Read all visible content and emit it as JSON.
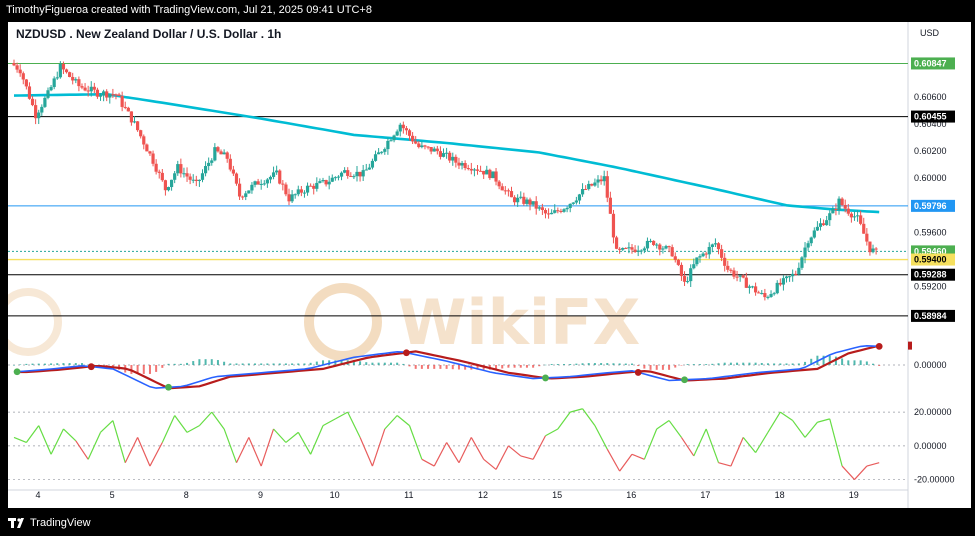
{
  "header": {
    "caption": "TimothyFigueroa created with TradingView.com, Jul 21, 2025 09:41 UTC+8"
  },
  "footer": {
    "brand": "TradingView"
  },
  "watermark": {
    "text": "WikiFX"
  },
  "colors": {
    "up": "#26a69a",
    "down": "#ef5350",
    "ema": "#00bcd4",
    "macd_line": "#2962ff",
    "signal_line": "#4caf50",
    "signal_down": "#b71c1c",
    "hist_pos": "#26a69a",
    "hist_neg": "#ef5350",
    "osc_pos": "#66dd44",
    "osc_neg": "#e85c5c",
    "level_green": "#4caf50",
    "level_blue": "#2196f3",
    "level_yellow": "#f6e05e",
    "level_black": "#000000"
  },
  "chart_data": {
    "type": "candlestick",
    "title": "NZDUSD . New Zealand Dollar / U.S. Dollar . 1h",
    "currency": "USD",
    "timeframe": "1h",
    "y_range": [
      0.5888,
      0.6102
    ],
    "y_ticks": [
      0.606,
      0.604,
      0.602,
      0.6,
      0.596,
      0.592,
      0.59
    ],
    "y_tick_labels": [
      "0.60600",
      "0.60400",
      "0.60200",
      "0.60000",
      "0.59600",
      "0.59200",
      "0.59000"
    ],
    "x_labels": [
      "4",
      "5",
      "8",
      "9",
      "10",
      "11",
      "12",
      "15",
      "16",
      "17",
      "18",
      "19"
    ],
    "x_label_index": [
      0,
      24,
      48,
      72,
      96,
      120,
      144,
      168,
      192,
      216,
      240,
      264
    ],
    "total_bars": 280,
    "price_anchors": [
      [
        0,
        0.6085
      ],
      [
        3,
        0.608
      ],
      [
        8,
        0.6047
      ],
      [
        12,
        0.6062
      ],
      [
        16,
        0.6082
      ],
      [
        22,
        0.6068
      ],
      [
        28,
        0.6063
      ],
      [
        34,
        0.6062
      ],
      [
        40,
        0.604
      ],
      [
        46,
        0.6013
      ],
      [
        50,
        0.5992
      ],
      [
        54,
        0.6008
      ],
      [
        60,
        0.5995
      ],
      [
        66,
        0.602
      ],
      [
        70,
        0.6015
      ],
      [
        74,
        0.5987
      ],
      [
        80,
        0.5997
      ],
      [
        86,
        0.6003
      ],
      [
        90,
        0.5985
      ],
      [
        96,
        0.5993
      ],
      [
        102,
        0.5997
      ],
      [
        108,
        0.6005
      ],
      [
        114,
        0.6003
      ],
      [
        120,
        0.6021
      ],
      [
        126,
        0.604
      ],
      [
        132,
        0.6023
      ],
      [
        138,
        0.602
      ],
      [
        144,
        0.6012
      ],
      [
        150,
        0.6008
      ],
      [
        156,
        0.6002
      ],
      [
        162,
        0.5985
      ],
      [
        168,
        0.5982
      ],
      [
        174,
        0.5972
      ],
      [
        180,
        0.598
      ],
      [
        186,
        0.5992
      ],
      [
        192,
        0.6
      ],
      [
        196,
        0.5945
      ],
      [
        202,
        0.5948
      ],
      [
        208,
        0.5953
      ],
      [
        214,
        0.5945
      ],
      [
        218,
        0.5922
      ],
      [
        222,
        0.594
      ],
      [
        228,
        0.5952
      ],
      [
        232,
        0.5933
      ],
      [
        238,
        0.5922
      ],
      [
        244,
        0.5912
      ],
      [
        248,
        0.592
      ],
      [
        254,
        0.593
      ],
      [
        258,
        0.5955
      ],
      [
        262,
        0.5966
      ],
      [
        266,
        0.5975
      ],
      [
        268,
        0.5983
      ],
      [
        270,
        0.5978
      ],
      [
        274,
        0.597
      ],
      [
        278,
        0.5948
      ],
      [
        280,
        0.5945
      ]
    ],
    "ema_anchors": [
      [
        0,
        0.6061
      ],
      [
        30,
        0.6062
      ],
      [
        50,
        0.6055
      ],
      [
        80,
        0.6044
      ],
      [
        110,
        0.6032
      ],
      [
        140,
        0.6026
      ],
      [
        170,
        0.6019
      ],
      [
        195,
        0.6008
      ],
      [
        225,
        0.5993
      ],
      [
        250,
        0.598
      ],
      [
        265,
        0.5977
      ],
      [
        280,
        0.5975
      ]
    ],
    "levels": [
      {
        "value": 0.60847,
        "label": "0.60847",
        "type": "green"
      },
      {
        "value": 0.60455,
        "label": "0.60455",
        "type": "black"
      },
      {
        "value": 0.59796,
        "label": "0.59796",
        "type": "blue"
      },
      {
        "value": 0.5946,
        "label": "0.59460",
        "type": "green"
      },
      {
        "value": 0.594,
        "label": "0.59400",
        "type": "yellow"
      },
      {
        "value": 0.59288,
        "label": "0.59288",
        "type": "black"
      },
      {
        "value": 0.58984,
        "label": "0.58984",
        "type": "black"
      }
    ],
    "macd": {
      "zero_label": "0.00000",
      "anchors": [
        [
          0,
          -0.00018
        ],
        [
          10,
          -0.00012
        ],
        [
          22,
          -2e-05
        ],
        [
          32,
          -0.0001
        ],
        [
          45,
          -0.0006
        ],
        [
          55,
          -0.00055
        ],
        [
          65,
          -0.0003
        ],
        [
          80,
          -0.0002
        ],
        [
          95,
          -0.0001
        ],
        [
          110,
          0.0002
        ],
        [
          125,
          0.00035
        ],
        [
          140,
          0.0001
        ],
        [
          155,
          -0.0002
        ],
        [
          168,
          -0.00035
        ],
        [
          180,
          -0.0003
        ],
        [
          192,
          -0.0002
        ],
        [
          200,
          -0.00015
        ],
        [
          212,
          -0.0004
        ],
        [
          225,
          -0.00035
        ],
        [
          240,
          -0.0002
        ],
        [
          255,
          -0.0001
        ],
        [
          265,
          0.0003
        ],
        [
          275,
          0.0005
        ],
        [
          280,
          0.00048
        ]
      ],
      "y_range": [
        -0.0008,
        0.0008
      ]
    },
    "oscillator": {
      "y_ticks": [
        20,
        0,
        -20
      ],
      "y_tick_labels": [
        "20.00000",
        "0.00000",
        "-20.00000"
      ],
      "y_range": [
        -25,
        26
      ],
      "anchors": [
        [
          0,
          5
        ],
        [
          4,
          2
        ],
        [
          8,
          12
        ],
        [
          12,
          -5
        ],
        [
          16,
          10
        ],
        [
          20,
          3
        ],
        [
          24,
          -8
        ],
        [
          28,
          8
        ],
        [
          32,
          15
        ],
        [
          36,
          -10
        ],
        [
          40,
          5
        ],
        [
          44,
          -12
        ],
        [
          48,
          2
        ],
        [
          52,
          18
        ],
        [
          56,
          8
        ],
        [
          60,
          12
        ],
        [
          64,
          20
        ],
        [
          68,
          10
        ],
        [
          72,
          -10
        ],
        [
          76,
          5
        ],
        [
          80,
          -12
        ],
        [
          84,
          10
        ],
        [
          88,
          2
        ],
        [
          92,
          8
        ],
        [
          96,
          -5
        ],
        [
          100,
          12
        ],
        [
          104,
          16
        ],
        [
          108,
          20
        ],
        [
          112,
          5
        ],
        [
          116,
          -12
        ],
        [
          120,
          10
        ],
        [
          124,
          18
        ],
        [
          128,
          12
        ],
        [
          132,
          -8
        ],
        [
          136,
          -12
        ],
        [
          140,
          2
        ],
        [
          144,
          -10
        ],
        [
          148,
          5
        ],
        [
          152,
          -8
        ],
        [
          156,
          -14
        ],
        [
          160,
          0
        ],
        [
          164,
          -6
        ],
        [
          168,
          -8
        ],
        [
          172,
          6
        ],
        [
          176,
          10
        ],
        [
          180,
          20
        ],
        [
          184,
          22
        ],
        [
          188,
          12
        ],
        [
          192,
          -2
        ],
        [
          196,
          -15
        ],
        [
          200,
          -5
        ],
        [
          204,
          -8
        ],
        [
          208,
          10
        ],
        [
          212,
          15
        ],
        [
          216,
          5
        ],
        [
          220,
          -6
        ],
        [
          224,
          10
        ],
        [
          228,
          -10
        ],
        [
          232,
          -12
        ],
        [
          236,
          5
        ],
        [
          240,
          -4
        ],
        [
          244,
          8
        ],
        [
          248,
          20
        ],
        [
          252,
          15
        ],
        [
          256,
          5
        ],
        [
          260,
          14
        ],
        [
          264,
          16
        ],
        [
          268,
          -12
        ],
        [
          272,
          -20
        ],
        [
          276,
          -12
        ],
        [
          280,
          -10
        ]
      ]
    }
  }
}
